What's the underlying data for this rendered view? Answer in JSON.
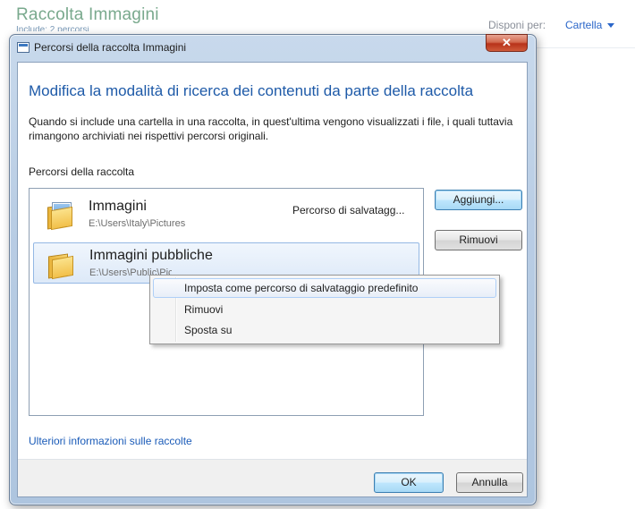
{
  "background": {
    "title": "Raccolta Immagini",
    "subtitle": "Include: 2 percorsi",
    "arrange_label": "Disponi per:",
    "arrange_value": "Cartella"
  },
  "dialog": {
    "title": "Percorsi della raccolta Immagini",
    "close_label": "✕",
    "heading": "Modifica la modalità di ricerca dei contenuti da parte della raccolta",
    "intro": "Quando si include una cartella in una raccolta, in quest'ultima vengono visualizzati i file, i quali tuttavia rimangono archiviati nei rispettivi percorsi originali.",
    "locations_label": "Percorsi della raccolta",
    "locations": [
      {
        "name": "Immagini",
        "path": "E:\\Users\\Italy\\Pictures",
        "badge": "Percorso di salvatagg..."
      },
      {
        "name": "Immagini pubbliche",
        "path": "E:\\Users\\Public\\Pictures",
        "badge": ""
      }
    ],
    "buttons": {
      "add": "Aggiungi...",
      "remove": "Rimuovi",
      "ok": "OK",
      "cancel": "Annulla"
    },
    "more_info_link": "Ulteriori informazioni sulle raccolte"
  },
  "context_menu": {
    "items": [
      "Imposta come percorso di salvataggio predefinito",
      "Rimuovi",
      "Sposta su"
    ]
  },
  "colors": {
    "heading": "#1e5aa8",
    "link": "#1a5bb8",
    "close_button": "#c44a2c"
  }
}
